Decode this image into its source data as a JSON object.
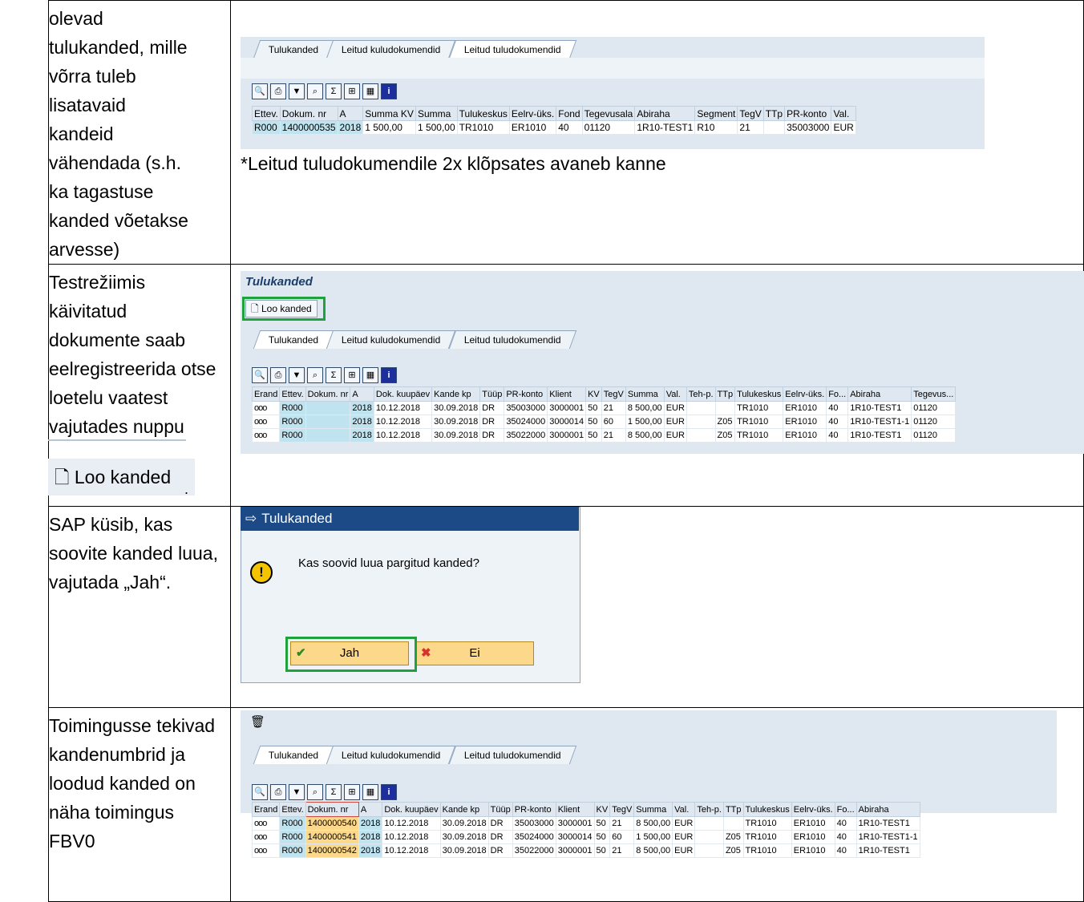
{
  "rows": [
    {
      "left_text": "olevad\ntulukanded, mille\nvõrra tuleb\nlisatavaid\nkandeid\nvähendada (s.h.\nka tagastuse\nkanded võetakse\narvesse)"
    },
    {
      "left_text": "Testrežiimis\nkäivitatud\ndokumente saab\neelregistreerida otse\nloetelu vaatest\nvajutades nuppu",
      "button_label": "Loo kanded",
      "trailing": "."
    },
    {
      "left_text": "SAP küsib, kas\nsoovite kanded luua,\nvajutada „Jah“."
    },
    {
      "left_text": "Toimingusse tekivad\nkandenumbrid ja\nloodud kanded on\nnäha toimingus\nFBV0"
    }
  ],
  "tabs": [
    "Tulukanded",
    "Leitud kuludokumendid",
    "Leitud tuludokumendid"
  ],
  "screen1": {
    "headers": [
      "Ettev.",
      "Dokum. nr",
      "A",
      "Summa KV",
      "Summa",
      "Tulukeskus",
      "Eelrv-üks.",
      "Fond",
      "Tegevusala",
      "Abiraha",
      "Segment",
      "TegV",
      "TTp",
      "PR-konto",
      "Val."
    ],
    "row": [
      "R000",
      "1400000535",
      "2018",
      "1 500,00",
      "1 500,00",
      "TR1010",
      "ER1010",
      "40",
      "01120",
      "1R10-TEST1",
      "R10",
      "21",
      "",
      "35003000",
      "EUR"
    ],
    "note": "*Leitud tuludokumendile 2x klõpsates avaneb kanne"
  },
  "screen2": {
    "title": "Tulukanded",
    "button": "Loo kanded",
    "headers": [
      "Erand",
      "Ettev.",
      "Dokum. nr",
      "A",
      "Dok. kuupäev",
      "Kande kp",
      "Tüüp",
      "PR-konto",
      "Klient",
      "KV",
      "TegV",
      "Summa",
      "Val.",
      "Teh-p.",
      "TTp",
      "Tulukeskus",
      "Eelrv-üks.",
      "Fo...",
      "Abiraha",
      "Tegevus..."
    ],
    "rows": [
      [
        "ooo",
        "R000",
        "",
        "2018",
        "10.12.2018",
        "30.09.2018",
        "DR",
        "35003000",
        "3000001",
        "50",
        "21",
        "8 500,00",
        "EUR",
        "",
        "",
        "TR1010",
        "ER1010",
        "40",
        "1R10-TEST1",
        "01120"
      ],
      [
        "ooo",
        "R000",
        "",
        "2018",
        "10.12.2018",
        "30.09.2018",
        "DR",
        "35024000",
        "3000014",
        "50",
        "60",
        "1 500,00",
        "EUR",
        "",
        "Z05",
        "TR1010",
        "ER1010",
        "40",
        "1R10-TEST1-1",
        "01120"
      ],
      [
        "ooo",
        "R000",
        "",
        "2018",
        "10.12.2018",
        "30.09.2018",
        "DR",
        "35022000",
        "3000001",
        "50",
        "21",
        "8 500,00",
        "EUR",
        "",
        "Z05",
        "TR1010",
        "ER1010",
        "40",
        "1R10-TEST1",
        "01120"
      ]
    ]
  },
  "dialog": {
    "title": "Tulukanded",
    "question": "Kas soovid luua pargitud kanded?",
    "yes": "Jah",
    "no": "Ei"
  },
  "screen4": {
    "headers": [
      "Erand",
      "Ettev.",
      "Dokum. nr",
      "A",
      "Dok. kuupäev",
      "Kande kp",
      "Tüüp",
      "PR-konto",
      "Klient",
      "KV",
      "TegV",
      "Summa",
      "Val.",
      "Teh-p.",
      "TTp",
      "Tulukeskus",
      "Eelrv-üks.",
      "Fo...",
      "Abiraha"
    ],
    "rows": [
      [
        "ooo",
        "R000",
        "1400000540",
        "2018",
        "10.12.2018",
        "30.09.2018",
        "DR",
        "35003000",
        "3000001",
        "50",
        "21",
        "8 500,00",
        "EUR",
        "",
        "",
        "TR1010",
        "ER1010",
        "40",
        "1R10-TEST1"
      ],
      [
        "ooo",
        "R000",
        "1400000541",
        "2018",
        "10.12.2018",
        "30.09.2018",
        "DR",
        "35024000",
        "3000014",
        "50",
        "60",
        "1 500,00",
        "EUR",
        "",
        "Z05",
        "TR1010",
        "ER1010",
        "40",
        "1R10-TEST1-1"
      ],
      [
        "ooo",
        "R000",
        "1400000542",
        "2018",
        "10.12.2018",
        "30.09.2018",
        "DR",
        "35022000",
        "3000001",
        "50",
        "21",
        "8 500,00",
        "EUR",
        "",
        "Z05",
        "TR1010",
        "ER1010",
        "40",
        "1R10-TEST1"
      ]
    ]
  }
}
